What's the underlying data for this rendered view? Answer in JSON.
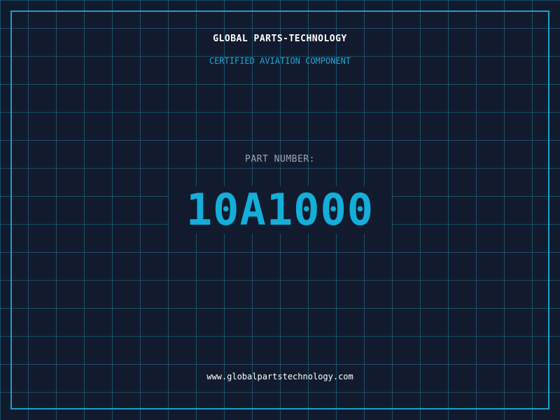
{
  "brand": {
    "name": "GLOBAL PARTS-TECHNOLOGY",
    "tagline": "CERTIFIED AVIATION COMPONENT"
  },
  "part": {
    "label": "PART NUMBER:",
    "number": "10A1000"
  },
  "footer": {
    "website": "www.globalpartstechnology.com"
  },
  "colors": {
    "background": "#121b2d",
    "grid": "#217896",
    "accent": "#1a9fc9",
    "part_number": "#13aed9"
  }
}
